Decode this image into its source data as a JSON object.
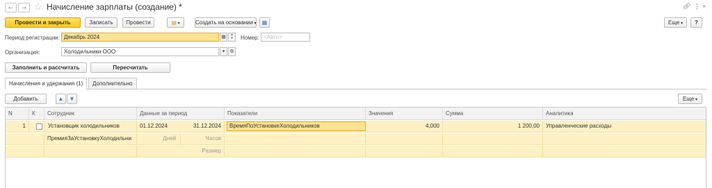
{
  "window": {
    "title": "Начисление зарплаты (создание) *",
    "link_icon": "link-icon",
    "menu_icon": "more-vertical-icon",
    "close_icon": "close-icon"
  },
  "toolbar": {
    "post_close": "Провести и закрыть",
    "save": "Записать",
    "post": "Провести",
    "create_based": "Создать на основании",
    "more": "Еще",
    "help": "?"
  },
  "form": {
    "period_label": "Период регистрации:",
    "period_value": "Декабрь 2024",
    "number_label": "Номер:",
    "number_placeholder": "<Авто>",
    "org_label": "Организация:",
    "org_value": "Холодильники ООО"
  },
  "actions": {
    "fill_calc": "Заполнить и рассчитать",
    "recalc": "Пересчитать"
  },
  "tabs": [
    {
      "label": "Начисления и удержания (1)",
      "active": true
    },
    {
      "label": "Дополнительно",
      "active": false
    }
  ],
  "table_toolbar": {
    "add": "Добавить",
    "more": "Еще"
  },
  "table": {
    "columns": [
      "N",
      "К",
      "Сотрудник",
      "Данные за период",
      "Показатели",
      "Значения",
      "Сумма",
      "Аналитика"
    ],
    "row": {
      "n": "1",
      "employee": "Установщик холодильников",
      "date_from": "01.12.2024",
      "date_to": "31.12.2024",
      "indicator": "ВремяПоУстановкеХолодильников",
      "value": "4,000",
      "sum": "1 200,00",
      "analytics": "Управленческие расходы",
      "accrual": "ПремияЗаУстановкуХолодильни",
      "days": "Дней",
      "hours": "Часов",
      "size": "Размер"
    }
  },
  "colors": {
    "primary": "#f8c91b",
    "row_highlight": "#fdf1c4",
    "selected_cell": "#fde38f"
  }
}
